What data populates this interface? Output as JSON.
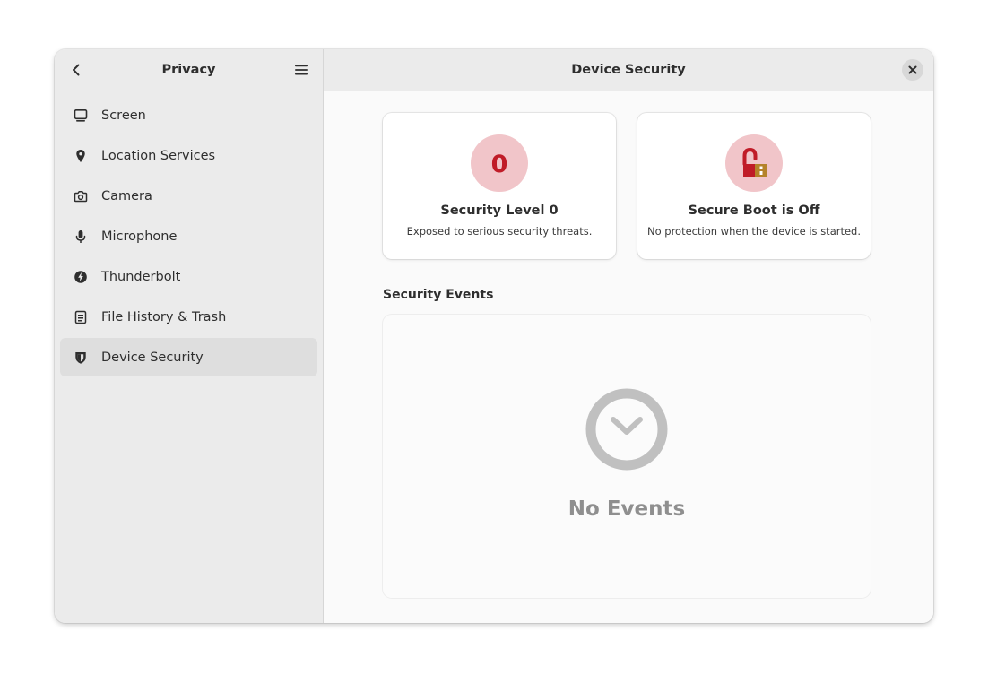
{
  "sidebar": {
    "title": "Privacy",
    "back_icon": "back-icon",
    "menu_icon": "menu-icon",
    "items": [
      {
        "label": "Screen",
        "icon": "monitor-icon"
      },
      {
        "label": "Location Services",
        "icon": "location-pin-icon"
      },
      {
        "label": "Camera",
        "icon": "camera-icon"
      },
      {
        "label": "Microphone",
        "icon": "microphone-icon"
      },
      {
        "label": "Thunderbolt",
        "icon": "thunderbolt-icon"
      },
      {
        "label": "File History & Trash",
        "icon": "file-history-icon"
      },
      {
        "label": "Device Security",
        "icon": "shield-icon",
        "selected": true
      }
    ]
  },
  "main": {
    "title": "Device Security",
    "close_icon": "close-icon",
    "cards": [
      {
        "title": "Security Level 0",
        "subtitle": "Exposed to serious security threats.",
        "icon_text": "0",
        "icon": "security-level-icon"
      },
      {
        "title": "Secure Boot is Off",
        "subtitle": "No protection when the device is started.",
        "icon": "unlocked-padlock-icon"
      }
    ],
    "events": {
      "section_title": "Security Events",
      "empty_label": "No Events",
      "icon": "clock-check-icon"
    }
  },
  "colors": {
    "danger_red": "#c01c28",
    "danger_bg": "#f1c5c9",
    "lock_gold": "#b5832a",
    "empty_gray": "#c0c0c0"
  }
}
